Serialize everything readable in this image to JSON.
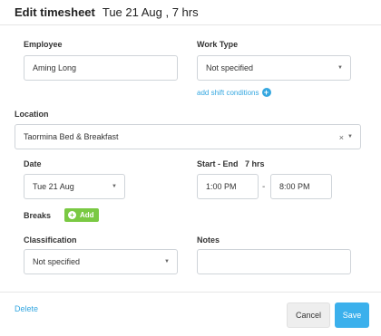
{
  "header": {
    "title": "Edit timesheet",
    "subtitle": "Tue 21 Aug , 7 hrs"
  },
  "employee": {
    "label": "Employee",
    "value": "Aming Long"
  },
  "work_type": {
    "label": "Work Type",
    "value": "Not specified",
    "add_shift_conditions": "add shift conditions"
  },
  "location": {
    "label": "Location",
    "value": "Taormina Bed & Breakfast",
    "clear_glyph": "×"
  },
  "date": {
    "label": "Date",
    "value": "Tue 21 Aug"
  },
  "start_end": {
    "label": "Start - End",
    "duration": "7 hrs",
    "start": "1:00 PM",
    "separator": "-",
    "end": "8:00 PM"
  },
  "breaks": {
    "label": "Breaks",
    "add_label": "Add"
  },
  "classification": {
    "label": "Classification",
    "value": "Not specified"
  },
  "notes": {
    "label": "Notes",
    "value": ""
  },
  "footer": {
    "delete_label": "Delete",
    "cancel_label": "Cancel",
    "save_label": "Save"
  },
  "icons": {
    "caret": "▼",
    "plus": "+"
  },
  "colors": {
    "accent": "#35a7e0",
    "save_button": "#3bb0ec",
    "add_button": "#7ac943"
  }
}
